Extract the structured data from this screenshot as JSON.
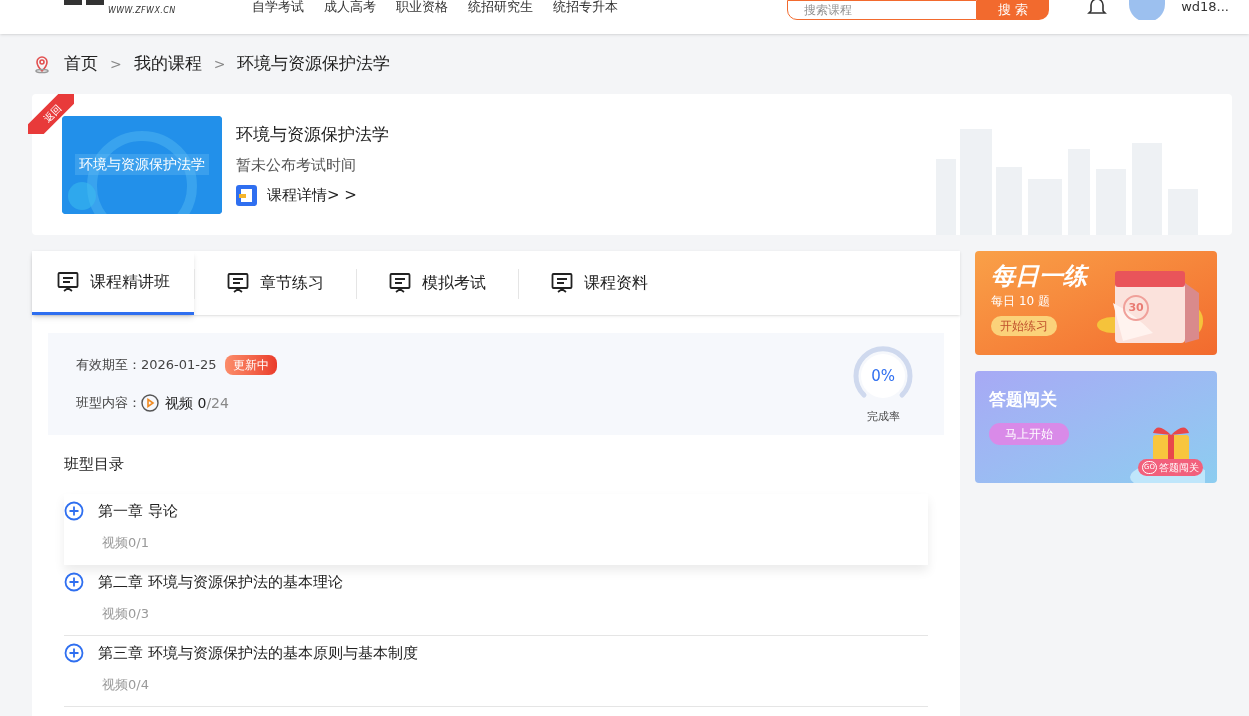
{
  "header": {
    "logo_url": "WWW.ZFWX.CN",
    "nav": [
      "自学考试",
      "成人高考",
      "职业资格",
      "统招研究生",
      "统招专升本"
    ],
    "search": {
      "placeholder": "搜索课程",
      "button": "搜 索"
    },
    "user": "wd18..."
  },
  "breadcrumb": {
    "separator": ">",
    "items": [
      "首页",
      "我的课程",
      "环境与资源保护法学"
    ]
  },
  "course": {
    "ribbon": "返回",
    "cover_title": "环境与资源保护法学",
    "title": "环境与资源保护法学",
    "exam_time": "暂未公布考试时间",
    "details_link": "课程详情> >"
  },
  "tabs": [
    {
      "label": "课程精讲班",
      "selected": true
    },
    {
      "label": "章节练习",
      "selected": false
    },
    {
      "label": "模拟考试",
      "selected": false
    },
    {
      "label": "课程资料",
      "selected": false
    }
  ],
  "class_info": {
    "validity_label": "有效期至：",
    "validity_date": "2026-01-25",
    "status_badge": "更新中",
    "content_label": "班型内容：",
    "video_label": "视频",
    "video_done": "0",
    "video_total": "/24",
    "progress": {
      "reading": "0%",
      "caption": "完成率"
    }
  },
  "catalog": {
    "title": "班型目录",
    "chapters": [
      {
        "title": "第一章 导论",
        "videos": "视频0/1",
        "highlighted": true
      },
      {
        "title": "第二章 环境与资源保护法的基本理论",
        "videos": "视频0/3",
        "highlighted": false
      },
      {
        "title": "第三章 环境与资源保护法的基本原则与基本制度",
        "videos": "视频0/4",
        "highlighted": false
      }
    ]
  },
  "promos": [
    {
      "kind": "daily",
      "title": "每日一练",
      "subtitle": "每日 10 题",
      "button": "开始练习",
      "badge": "30"
    },
    {
      "kind": "quiz",
      "title": "答题闯关",
      "button": "马上开始",
      "tag_go": "GO",
      "tag": "答题闯关"
    }
  ]
}
